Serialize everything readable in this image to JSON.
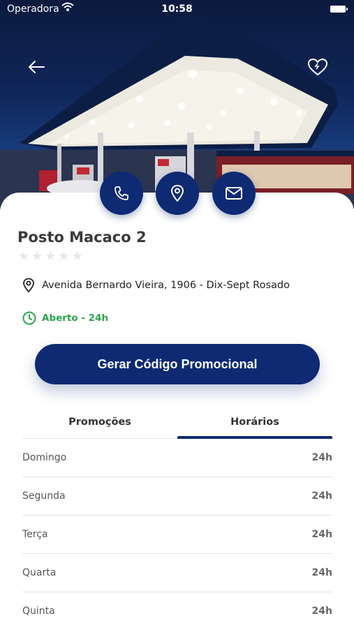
{
  "status_bar": {
    "carrier": "Operadora",
    "time": "10:58"
  },
  "colors": {
    "primary": "#0d2a73",
    "open": "#2ea44f"
  },
  "header": {
    "back_icon": "arrow-left-icon",
    "favorite_icon": "heart-icon"
  },
  "actions": [
    {
      "icon": "phone-icon"
    },
    {
      "icon": "map-pin-icon"
    },
    {
      "icon": "mail-icon"
    }
  ],
  "station": {
    "name": "Posto Macaco 2",
    "rating": 0,
    "rating_max": 5,
    "address": "Avenida Bernardo Vieira, 1906 - Dix-Sept Rosado",
    "status": "Aberto - 24h"
  },
  "cta_label": "Gerar Código Promocional",
  "tabs": [
    {
      "label": "Promoções",
      "active": false
    },
    {
      "label": "Horários",
      "active": true
    }
  ],
  "hours": [
    {
      "day": "Domingo",
      "hours": "24h"
    },
    {
      "day": "Segunda",
      "hours": "24h"
    },
    {
      "day": "Terça",
      "hours": "24h"
    },
    {
      "day": "Quarta",
      "hours": "24h"
    },
    {
      "day": "Quinta",
      "hours": "24h"
    }
  ]
}
